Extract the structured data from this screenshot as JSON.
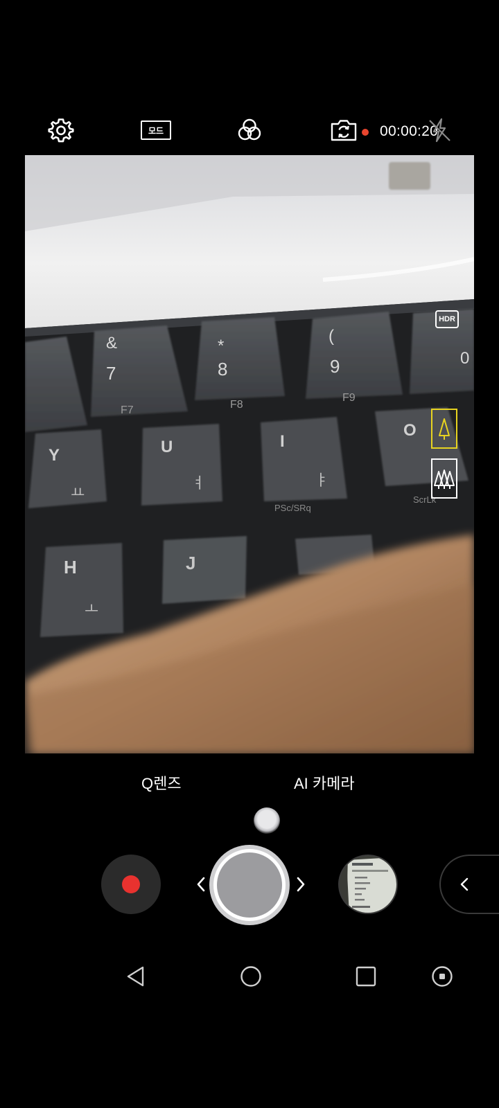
{
  "top_bar": {
    "settings_icon": "gear-icon",
    "mode_label": "모드",
    "filter_icon": "filter-circles-icon",
    "switch_camera_icon": "camera-switch-icon",
    "recording_timer": "00:00:20",
    "flash_icon": "flash-off-icon",
    "recording_indicator_color": "#e8452e"
  },
  "viewfinder": {
    "hdr_label": "HDR",
    "scene_close_icon": "single-tree-icon",
    "scene_wide_icon": "forest-icon",
    "selected_scene_color": "#e8d420",
    "keycaps": {
      "k1": "&",
      "k2": "7",
      "k3": "F7",
      "k4": "*",
      "k5": "8",
      "k6": "F8",
      "k7": "(",
      "k8": "9",
      "k9": "F9",
      "k10": "0",
      "k11": "Y",
      "k12": "ㅛ",
      "k13": "U",
      "k14": "ㅕ",
      "k15": "I",
      "k16": "ㅑ",
      "k17": "PSc/SRq",
      "k18": "O",
      "k19": "ScrLk",
      "k20": "H",
      "k21": "ㅗ",
      "k22": "J"
    }
  },
  "modes": {
    "left": "Q렌즈",
    "right": "AI 카메라"
  },
  "controls": {
    "record_icon": "record-icon",
    "record_color": "#e8322f",
    "prev_icon": "chevron-left-icon",
    "shutter": "shutter-button",
    "next_icon": "chevron-right-icon",
    "gallery_icon": "gallery-thumbnail",
    "drawer_icon": "chevron-left-icon"
  },
  "nav_bar": {
    "back_icon": "back-triangle-icon",
    "home_icon": "home-circle-icon",
    "recent_icon": "recent-square-icon",
    "capture_icon": "capture-dot-icon"
  }
}
